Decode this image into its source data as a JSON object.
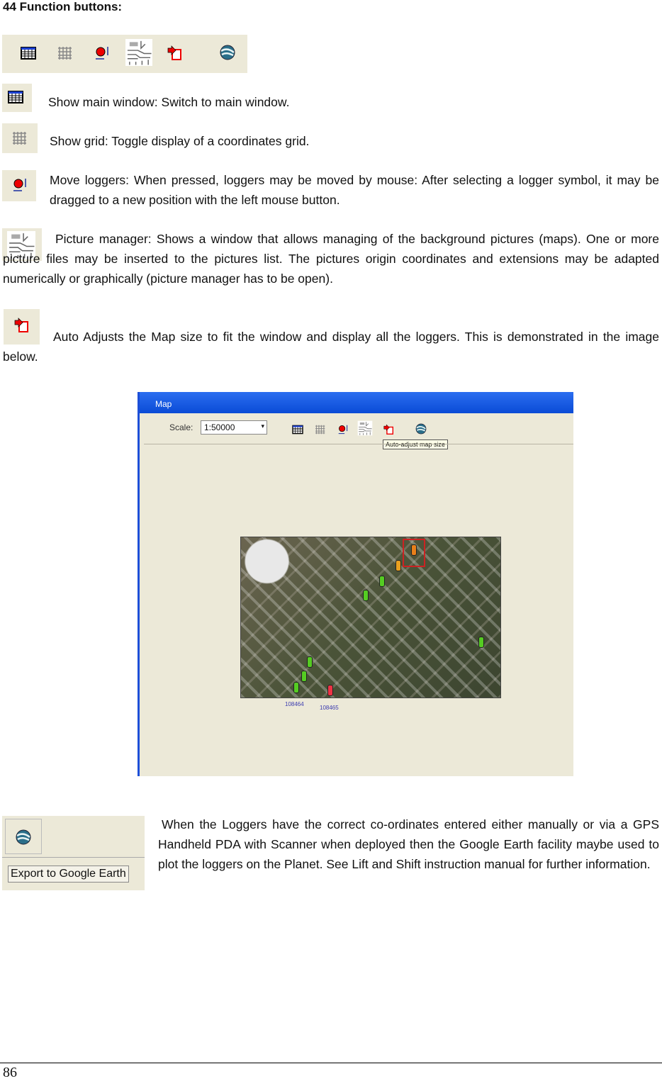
{
  "heading": "44  Function buttons:",
  "toolbar_icons": [
    "main-window-icon",
    "grid-icon",
    "move-loggers-icon",
    "picture-manager-icon",
    "auto-adjust-icon",
    "google-earth-icon"
  ],
  "items": [
    {
      "icon": "main-window-icon",
      "text": "Show main window: Switch to main window."
    },
    {
      "icon": "grid-icon",
      "text": "Show grid: Toggle display of a coordinates grid."
    },
    {
      "icon": "move-loggers-icon",
      "text": "Move loggers: When pressed, loggers may be moved by mouse: After selecting a logger symbol, it may be dragged to a new position with the left mouse button."
    },
    {
      "icon": "picture-manager-icon",
      "text": "Picture manager: Shows a window that allows managing of the background pictures (maps). One or more picture files may be inserted to the pictures list. The pictures origin coordinates and extensions may be adapted numerically or graphically (picture manager has to be open)."
    },
    {
      "icon": "auto-adjust-icon",
      "text": "Auto Adjusts the Map size to fit the window and display all the loggers. This is demonstrated in the image below."
    }
  ],
  "map_window": {
    "title": "Map",
    "scale_label": "Scale:",
    "scale_value": "1:50000",
    "tooltip": "Auto-adjust map size",
    "logger_labels": [
      "108464",
      "108465"
    ]
  },
  "google_earth": {
    "button_label": "Export to Google Earth",
    "text": "When the Loggers have the correct co-ordinates entered either manually or via a GPS Handheld PDA with Scanner when deployed then the Google Earth facility maybe used to plot the loggers on the Planet. See Lift and Shift instruction manual for further information."
  },
  "page_number": "86",
  "colors": {
    "toolbar_bg": "#ece9d8",
    "titlebar": "#0a4bd6"
  }
}
